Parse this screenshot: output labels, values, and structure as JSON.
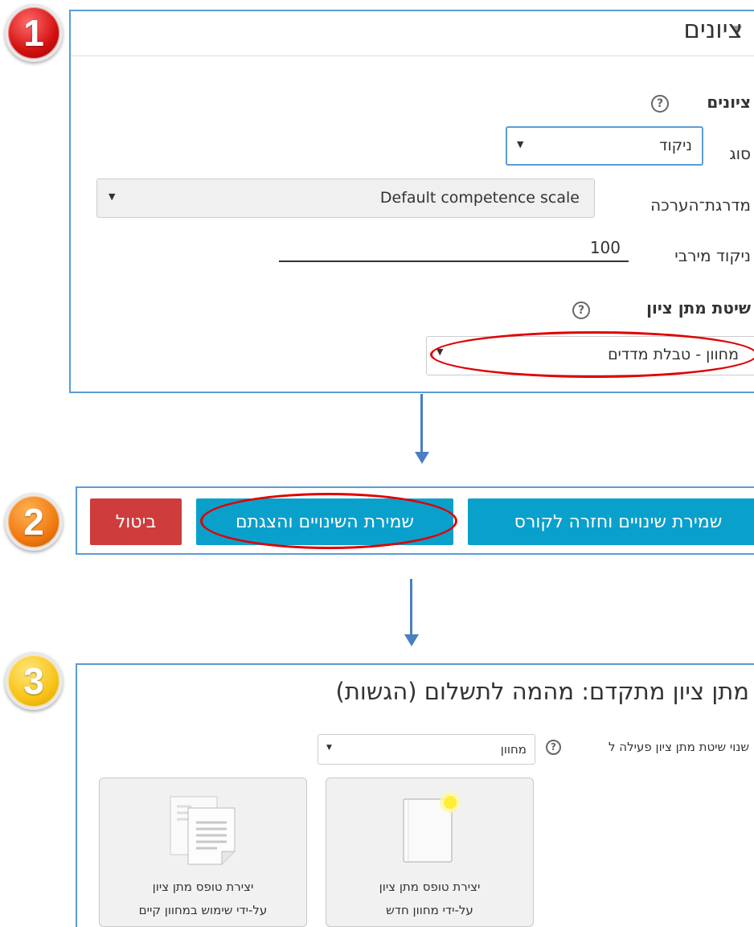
{
  "steps": [
    "1",
    "2",
    "3"
  ],
  "grades": {
    "section_title": "ציונים",
    "subsection_title": "ציונים",
    "type_label": "סוג",
    "type_value": "ניקוד",
    "scale_label": "מדרגת־הערכה",
    "scale_value": "Default competence scale",
    "max_points_label": "ניקוד מירבי",
    "max_points_value": "100",
    "method_title": "שיטת מתן ציון",
    "method_value": "מחוון - טבלת מדדים"
  },
  "buttons": {
    "save_return": "שמירת שינויים וחזרה לקורס",
    "save_display": "שמירת השינויים והצגתם",
    "cancel": "ביטול"
  },
  "advanced": {
    "title": "מתן ציון מתקדם: מהמה לתשלום (הגשות)",
    "change_method_label": "שנוי שיטת מתן ציון פעילה ל",
    "change_method_value": "מחוון",
    "new_form_line1": "יצירת טופס מתן ציון",
    "new_form_line2": "על-ידי מחוון חדש",
    "existing_form_line1": "יצירת טופס מתן ציון",
    "existing_form_line2": "על-ידי שימוש במחוון קיים"
  },
  "colors": {
    "panel_border": "#5b9bd5",
    "highlight": "#e00000",
    "button_blue": "#0aa0cc",
    "button_red": "#cf3c3c",
    "badge1": "#d21010",
    "badge2": "#f07a10",
    "badge3": "#f7c316"
  },
  "icons": [
    "help-icon",
    "dropdown-caret-icon",
    "new-rubric-icon",
    "copy-rubric-icon",
    "arrow-down-icon"
  ]
}
